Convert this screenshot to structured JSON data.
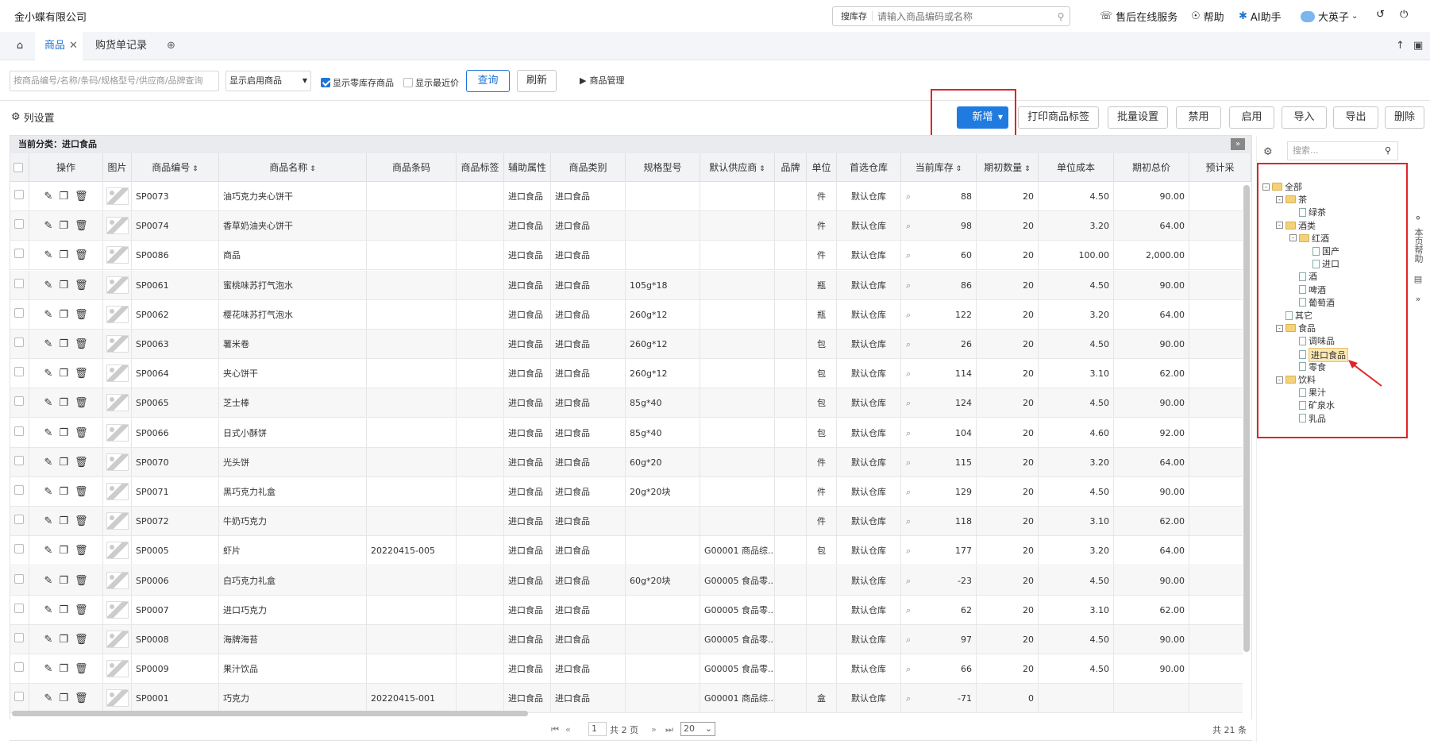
{
  "app": {
    "company": "金小蝶有限公司"
  },
  "topsearch": {
    "type": "搜库存",
    "placeholder": "请输入商品编码或名称"
  },
  "topnav": {
    "service": "售后在线服务",
    "help": "帮助",
    "ai": "AI助手",
    "user": "大英子"
  },
  "tabs": [
    {
      "label": "商品"
    },
    {
      "label": "购货单记录"
    }
  ],
  "filters": {
    "keyword_placeholder": "按商品编号/名称/条码/规格型号/供应商/品牌查询",
    "status": "显示启用商品",
    "show_zero": "显示零库存商品",
    "show_expiry": "显示最近价",
    "query": "查询",
    "refresh": "刷新",
    "manage": "商品管理"
  },
  "toolbar": {
    "column_settings": "列设置",
    "add": "新增",
    "print": "打印商品标签",
    "batch": "批量设置",
    "disable": "禁用",
    "enable": "启用",
    "import": "导入",
    "export": "导出",
    "delete": "删除"
  },
  "grid": {
    "category_title": "当前分类：进口食品",
    "headers": [
      "操作",
      "图片",
      "商品编号",
      "商品名称",
      "商品条码",
      "商品标签",
      "辅助属性",
      "商品类别",
      "规格型号",
      "默认供应商",
      "品牌",
      "单位",
      "首选仓库",
      "当前库存",
      "期初数量",
      "单位成本",
      "期初总价",
      "预计采"
    ],
    "rows": [
      [
        "SP0073",
        "油巧克力夹心饼干",
        "",
        "进口食品",
        "",
        "",
        "件",
        "默认仓库",
        "88",
        "20",
        "4.50",
        "90.00"
      ],
      [
        "SP0074",
        "香草奶油夹心饼干",
        "",
        "进口食品",
        "",
        "",
        "件",
        "默认仓库",
        "98",
        "20",
        "3.20",
        "64.00"
      ],
      [
        "SP0086",
        "商品",
        "",
        "进口食品",
        "",
        "",
        "件",
        "默认仓库",
        "60",
        "20",
        "100.00",
        "2,000.00"
      ],
      [
        "SP0061",
        "蜜桃味苏打气泡水",
        "",
        "进口食品",
        "105g*18",
        "",
        "瓶",
        "默认仓库",
        "86",
        "20",
        "4.50",
        "90.00"
      ],
      [
        "SP0062",
        "樱花味苏打气泡水",
        "",
        "进口食品",
        "260g*12",
        "",
        "瓶",
        "默认仓库",
        "122",
        "20",
        "3.20",
        "64.00"
      ],
      [
        "SP0063",
        "薯米卷",
        "",
        "进口食品",
        "260g*12",
        "",
        "包",
        "默认仓库",
        "26",
        "20",
        "4.50",
        "90.00"
      ],
      [
        "SP0064",
        "夹心饼干",
        "",
        "进口食品",
        "260g*12",
        "",
        "包",
        "默认仓库",
        "114",
        "20",
        "3.10",
        "62.00"
      ],
      [
        "SP0065",
        "芝士棒",
        "",
        "进口食品",
        "85g*40",
        "",
        "包",
        "默认仓库",
        "124",
        "20",
        "4.50",
        "90.00"
      ],
      [
        "SP0066",
        "日式小酥饼",
        "",
        "进口食品",
        "85g*40",
        "",
        "包",
        "默认仓库",
        "104",
        "20",
        "4.60",
        "92.00"
      ],
      [
        "SP0070",
        "光头饼",
        "",
        "进口食品",
        "60g*20",
        "",
        "件",
        "默认仓库",
        "115",
        "20",
        "3.20",
        "64.00"
      ],
      [
        "SP0071",
        "黑巧克力礼盒",
        "",
        "进口食品",
        "20g*20块",
        "",
        "件",
        "默认仓库",
        "129",
        "20",
        "4.50",
        "90.00"
      ],
      [
        "SP0072",
        "牛奶巧克力",
        "",
        "进口食品",
        "",
        "",
        "件",
        "默认仓库",
        "118",
        "20",
        "3.10",
        "62.00"
      ],
      [
        "SP0005",
        "虾片",
        "20220415-005",
        "进口食品",
        "",
        "G00001 商品综...",
        "包",
        "默认仓库",
        "177",
        "20",
        "3.20",
        "64.00"
      ],
      [
        "SP0006",
        "白巧克力礼盒",
        "",
        "进口食品",
        "60g*20块",
        "G00005 食品零...",
        "",
        "默认仓库",
        "-23",
        "20",
        "4.50",
        "90.00"
      ],
      [
        "SP0007",
        "进口巧克力",
        "",
        "进口食品",
        "",
        "G00005 食品零...",
        "",
        "默认仓库",
        "62",
        "20",
        "3.10",
        "62.00"
      ],
      [
        "SP0008",
        "海牌海苔",
        "",
        "进口食品",
        "",
        "G00005 食品零...",
        "",
        "默认仓库",
        "97",
        "20",
        "4.50",
        "90.00"
      ],
      [
        "SP0009",
        "果汁饮品",
        "",
        "进口食品",
        "",
        "G00005 食品零...",
        "",
        "默认仓库",
        "66",
        "20",
        "4.50",
        "90.00"
      ],
      [
        "SP0001",
        "巧克力",
        "20220415-001",
        "进口食品",
        "",
        "G00001 商品综...",
        "盒",
        "默认仓库",
        "-71",
        "0",
        "",
        ""
      ]
    ]
  },
  "pager": {
    "page": "1",
    "total_pages": "共 2 页",
    "page_size": "20",
    "total": "共 21 条"
  },
  "tree": {
    "search_placeholder": "搜索...",
    "nodes": [
      {
        "label": "全部",
        "level": 0,
        "type": "folder",
        "pm": "-"
      },
      {
        "label": "茶",
        "level": 1,
        "type": "folder",
        "pm": "-"
      },
      {
        "label": "绿茶",
        "level": 2,
        "type": "file"
      },
      {
        "label": "酒类",
        "level": 1,
        "type": "folder",
        "pm": "-"
      },
      {
        "label": "红酒",
        "level": 2,
        "type": "folder",
        "pm": "-"
      },
      {
        "label": "国产",
        "level": 3,
        "type": "file"
      },
      {
        "label": "进口",
        "level": 3,
        "type": "file"
      },
      {
        "label": "酒",
        "level": 2,
        "type": "file"
      },
      {
        "label": "啤酒",
        "level": 2,
        "type": "file"
      },
      {
        "label": "葡萄酒",
        "level": 2,
        "type": "file"
      },
      {
        "label": "其它",
        "level": 1,
        "type": "file"
      },
      {
        "label": "食品",
        "level": 1,
        "type": "folder",
        "pm": "-"
      },
      {
        "label": "调味品",
        "level": 2,
        "type": "file"
      },
      {
        "label": "进口食品",
        "level": 2,
        "type": "file",
        "selected": true
      },
      {
        "label": "零食",
        "level": 2,
        "type": "file"
      },
      {
        "label": "饮料",
        "level": 1,
        "type": "folder",
        "pm": "-"
      },
      {
        "label": "果汁",
        "level": 2,
        "type": "file"
      },
      {
        "label": "矿泉水",
        "level": 2,
        "type": "file"
      },
      {
        "label": "乳品",
        "level": 2,
        "type": "file"
      }
    ]
  },
  "side": {
    "help": "本页帮助"
  },
  "colors": {
    "accent": "#1f74d8",
    "highlight": "#e0232a"
  }
}
